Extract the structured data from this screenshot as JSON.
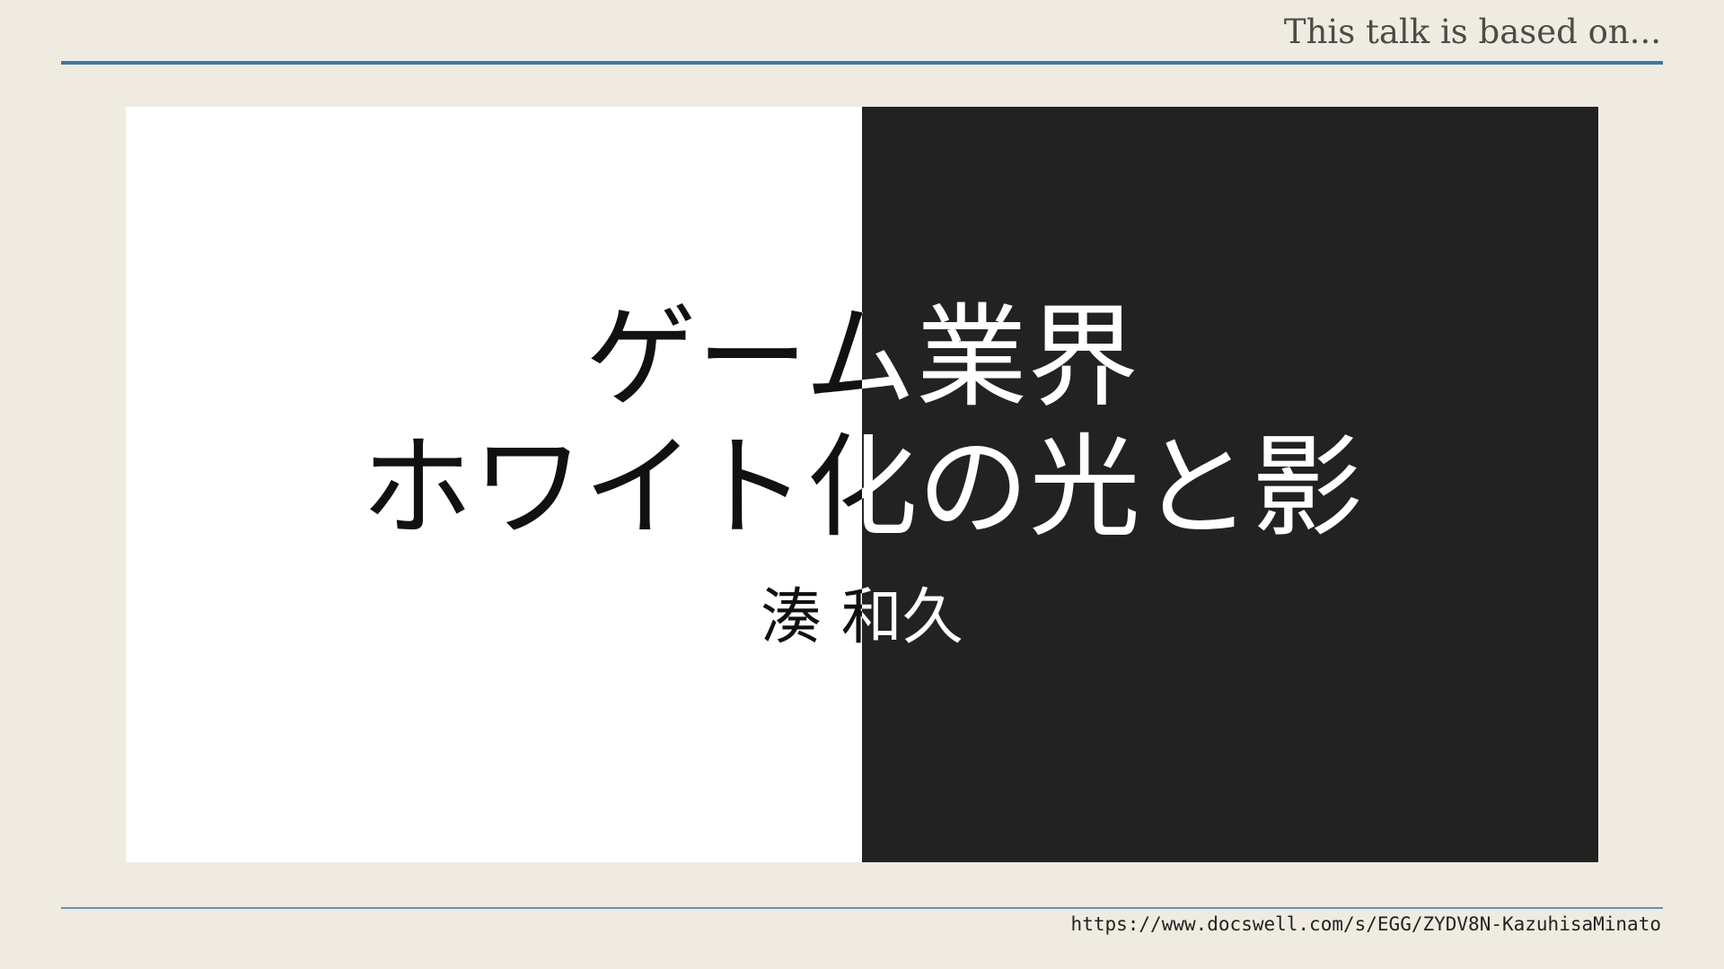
{
  "header": {
    "title": "This talk is based on..."
  },
  "slide": {
    "title_line_1": "ゲーム業界",
    "title_line_2": "ホワイト化の光と影",
    "author": "湊 和久",
    "colors": {
      "light_half": "#ffffff",
      "dark_half": "#222222"
    }
  },
  "footer": {
    "url": "https://www.docswell.com/s/EGG/ZYDV8N-KazuhisaMinato"
  },
  "colors": {
    "background": "#efebe1",
    "accent_rule": "#3a77a7"
  }
}
